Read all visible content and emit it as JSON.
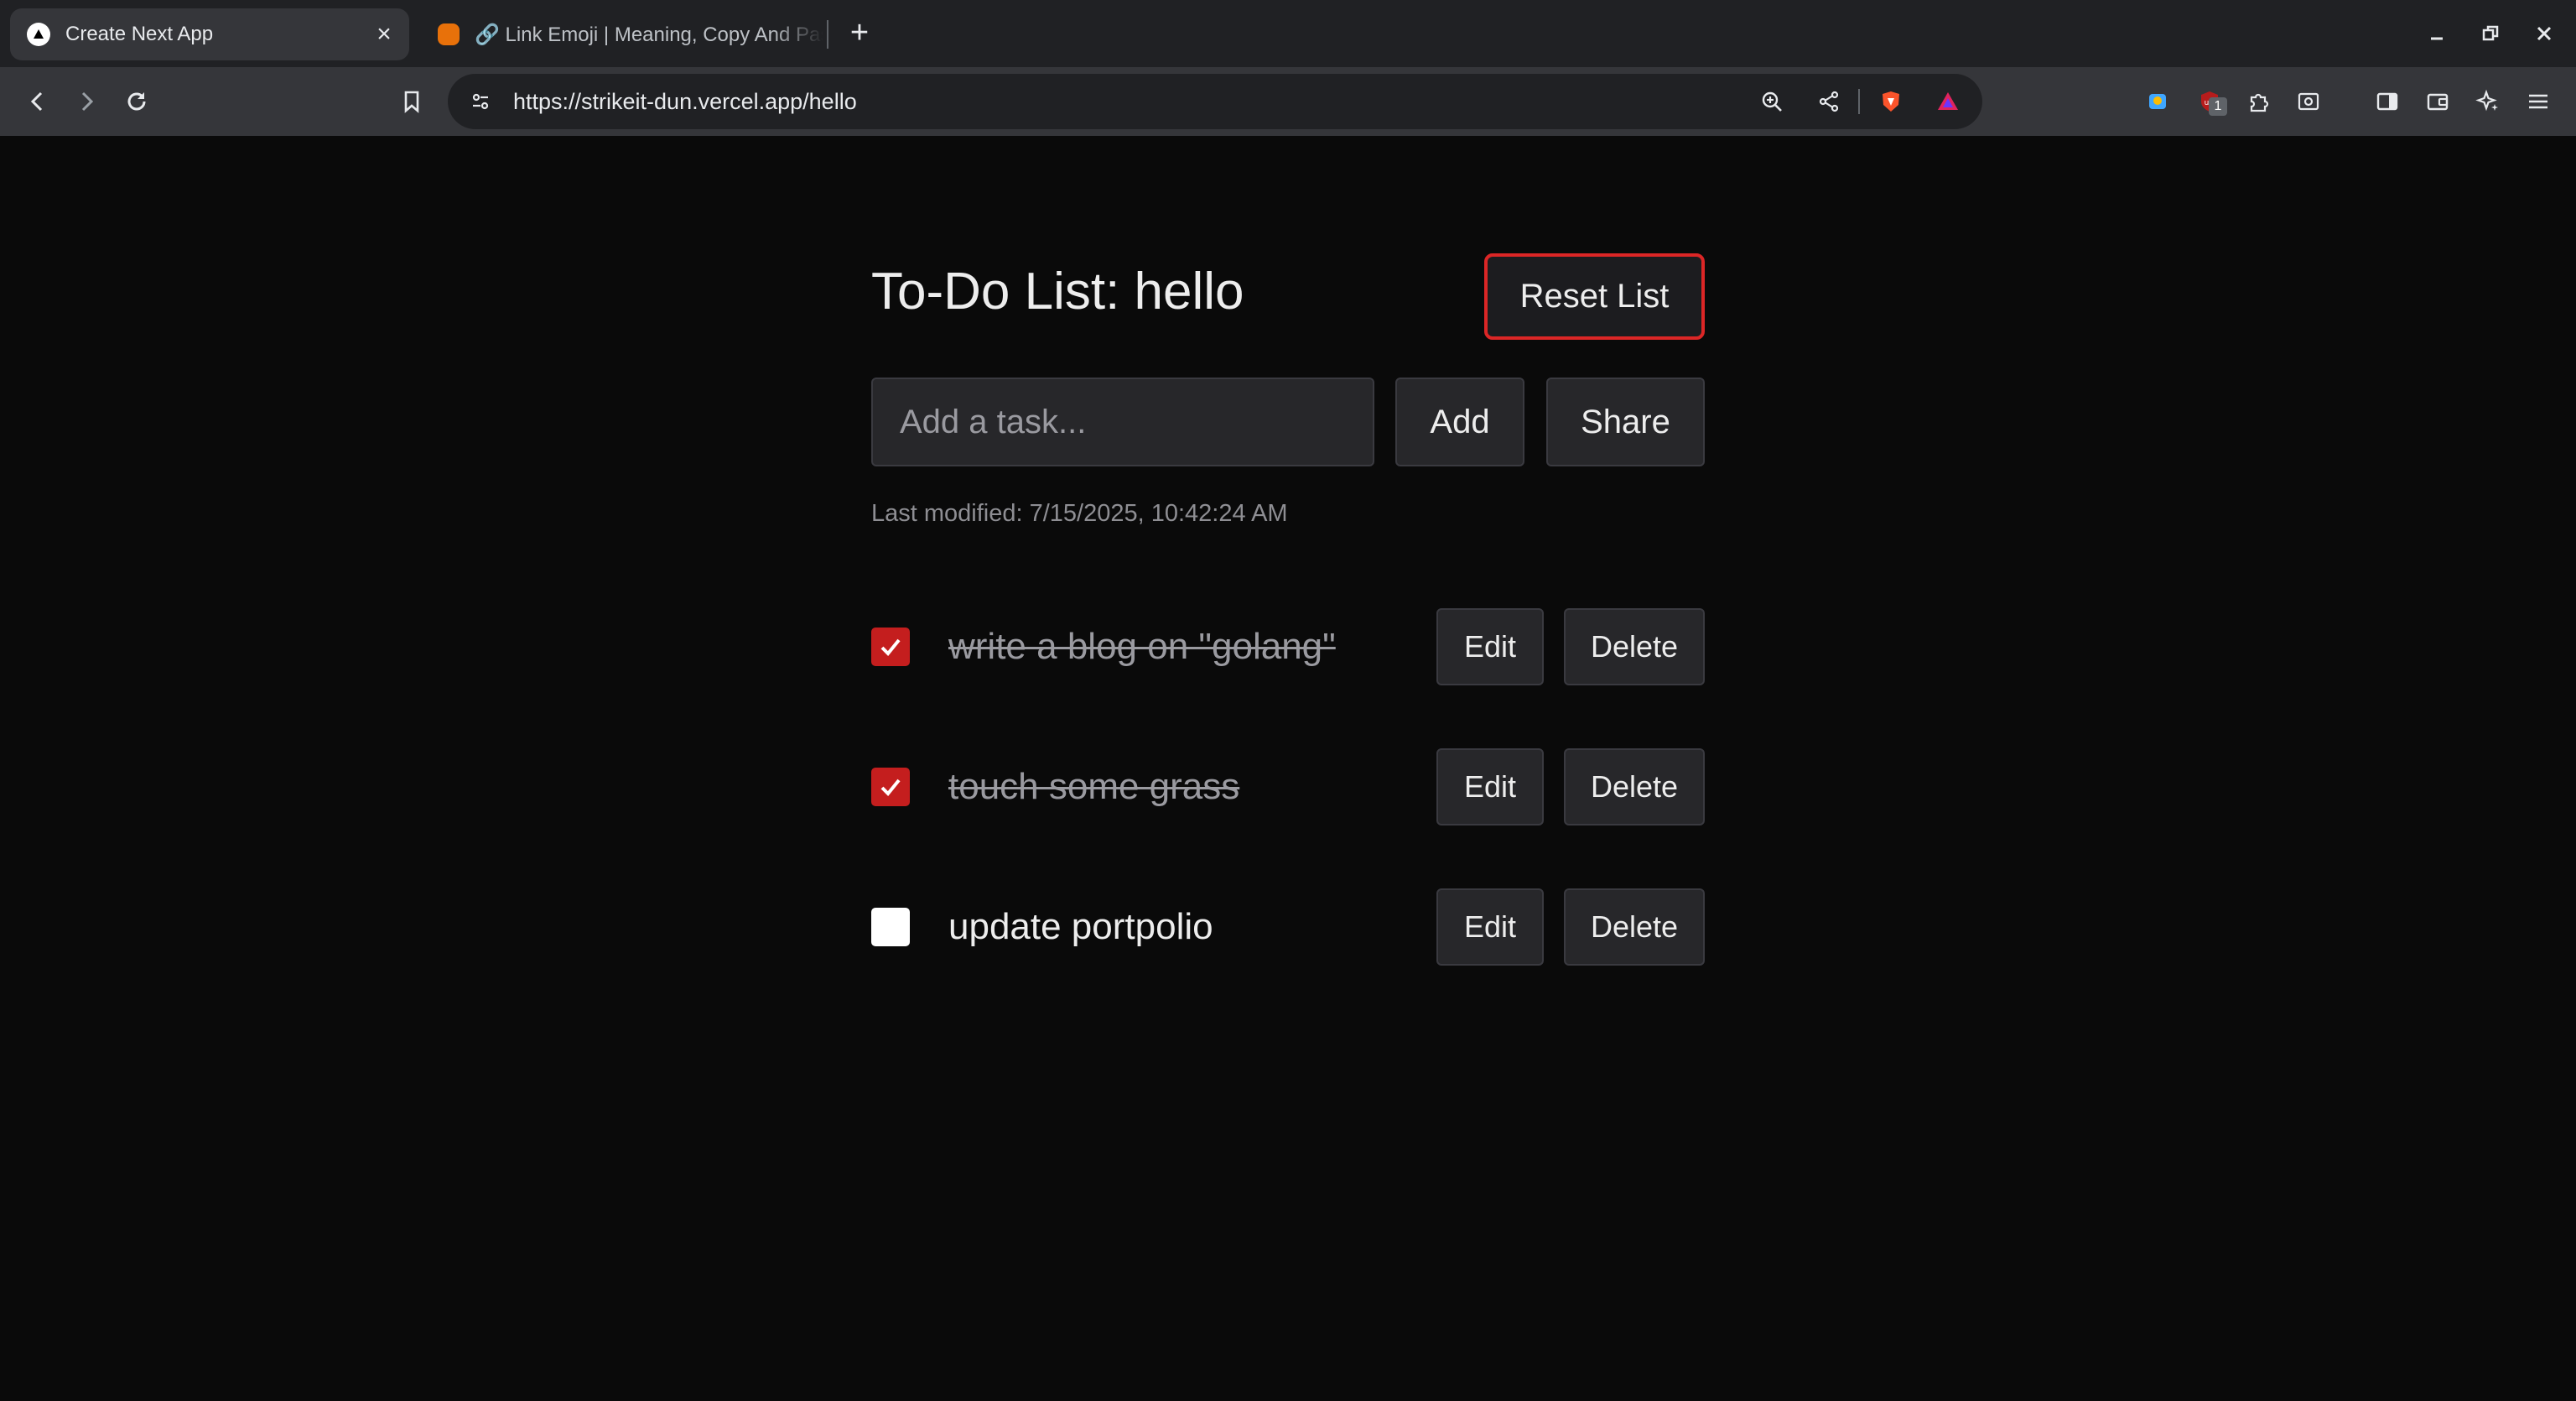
{
  "browser": {
    "tabs": [
      {
        "title": "Create Next App",
        "favicon": "nextjs-logo-icon",
        "active": true
      },
      {
        "title": "🔗 Link Emoji | Meaning, Copy And Paste",
        "favicon": "emojipedia-icon",
        "active": false
      }
    ],
    "new_tab_label": "+",
    "url": "https://strikeit-dun.vercel.app/hello",
    "extension_badge": "1"
  },
  "app": {
    "title": "To-Do List: hello",
    "reset_label": "Reset List",
    "input": {
      "placeholder": "Add a task...",
      "value": ""
    },
    "add_label": "Add",
    "share_label": "Share",
    "last_modified": "Last modified: 7/15/2025, 10:42:24 AM",
    "edit_label": "Edit",
    "delete_label": "Delete",
    "todos": [
      {
        "text": "write a blog on \"golang\"",
        "done": true
      },
      {
        "text": "touch some grass",
        "done": true
      },
      {
        "text": "update portpolio",
        "done": false
      }
    ]
  },
  "colors": {
    "background": "#0a0a0a",
    "accent_red": "#dc2626",
    "checkbox_checked": "#c41e1e",
    "button_bg": "#27272a"
  }
}
